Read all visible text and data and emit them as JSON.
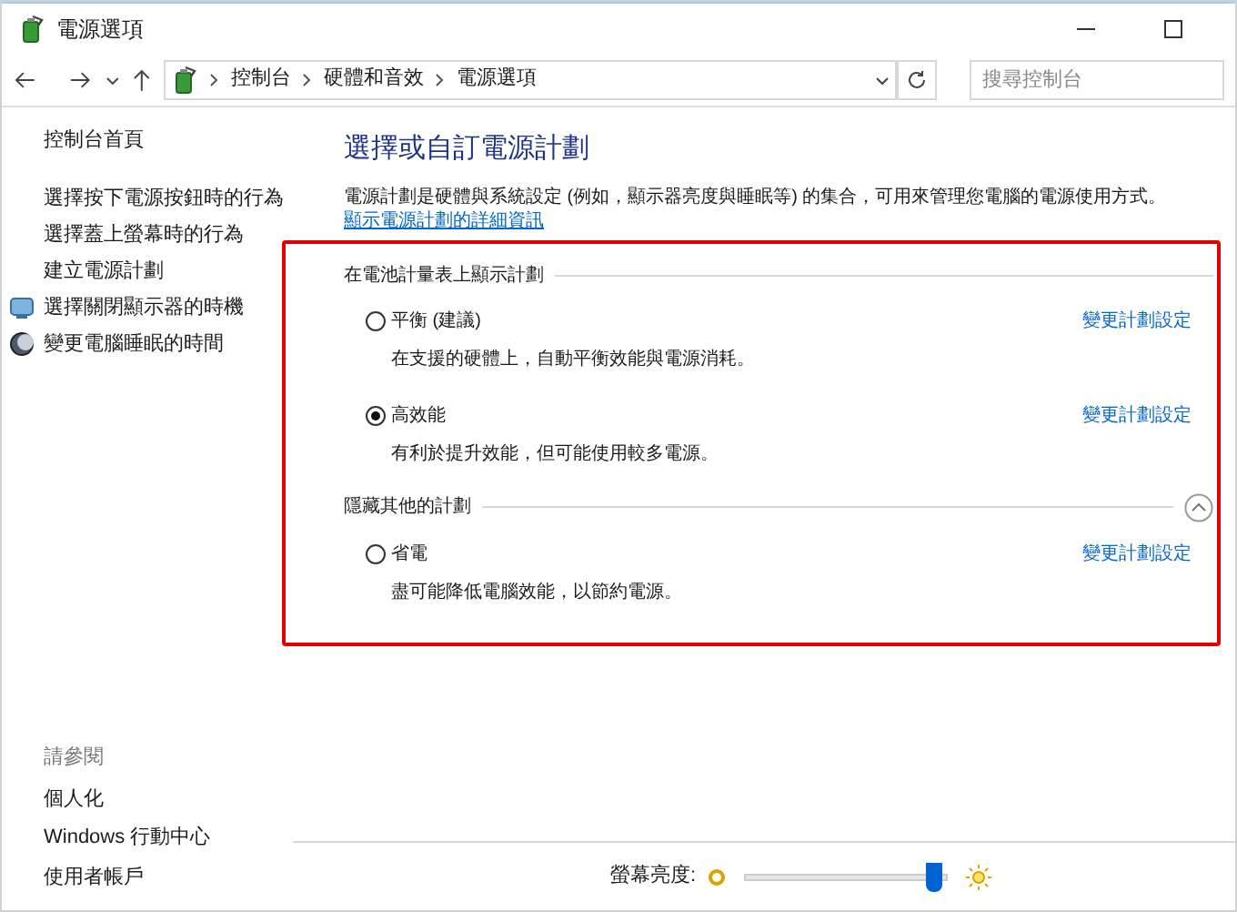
{
  "window": {
    "title": "電源選項"
  },
  "address_bar": {
    "breadcrumbs": [
      "控制台",
      "硬體和音效",
      "電源選項"
    ],
    "search_placeholder": "搜尋控制台"
  },
  "sidebar": {
    "home": "控制台首頁",
    "items": [
      {
        "label": "選擇按下電源按鈕時的行為",
        "kind": "plain"
      },
      {
        "label": "選擇蓋上螢幕時的行為",
        "kind": "plain"
      },
      {
        "label": "建立電源計劃",
        "kind": "plain"
      },
      {
        "label": "選擇關閉顯示器的時機",
        "kind": "display"
      },
      {
        "label": "變更電腦睡眠的時間",
        "kind": "sleep"
      }
    ],
    "see_also_heading": "請參閱",
    "see_also": [
      "個人化",
      "Windows 行動中心",
      "使用者帳戶"
    ]
  },
  "main": {
    "title": "選擇或自訂電源計劃",
    "description": "電源計劃是硬體與系統設定 (例如，顯示器亮度與睡眠等) 的集合，可用來管理您電腦的電源使用方式。",
    "description_link": "顯示電源計劃的詳細資訊",
    "groups": [
      {
        "heading": "在電池計量表上顯示計劃",
        "collapsible": false,
        "plans": [
          {
            "name": "平衡 (建議)",
            "description": "在支援的硬體上，自動平衡效能與電源消耗。",
            "selected": false,
            "link": "變更計劃設定"
          },
          {
            "name": "高效能",
            "description": "有利於提升效能，但可能使用較多電源。",
            "selected": true,
            "link": "變更計劃設定"
          }
        ]
      },
      {
        "heading": "隱藏其他的計劃",
        "collapsible": true,
        "plans": [
          {
            "name": "省電",
            "description": "盡可能降低電腦效能，以節約電源。",
            "selected": false,
            "link": "變更計劃設定"
          }
        ]
      }
    ]
  },
  "brightness": {
    "label": "螢幕亮度:",
    "level": 0.93
  }
}
